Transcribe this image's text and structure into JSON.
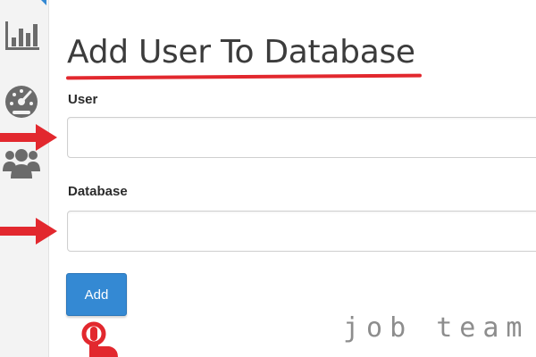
{
  "sidebar": {
    "icons": [
      "bar-chart-icon",
      "gauge-icon",
      "users-icon"
    ]
  },
  "form": {
    "title": "Add User To Database",
    "user_label": "User",
    "user_value": "",
    "database_label": "Database",
    "database_value": "",
    "add_label": "Add"
  },
  "colors": {
    "accent": "#e2282e",
    "button": "#3489d3",
    "sidebar_icon": "#6b6b6b"
  },
  "watermark": {
    "text": "job team"
  }
}
